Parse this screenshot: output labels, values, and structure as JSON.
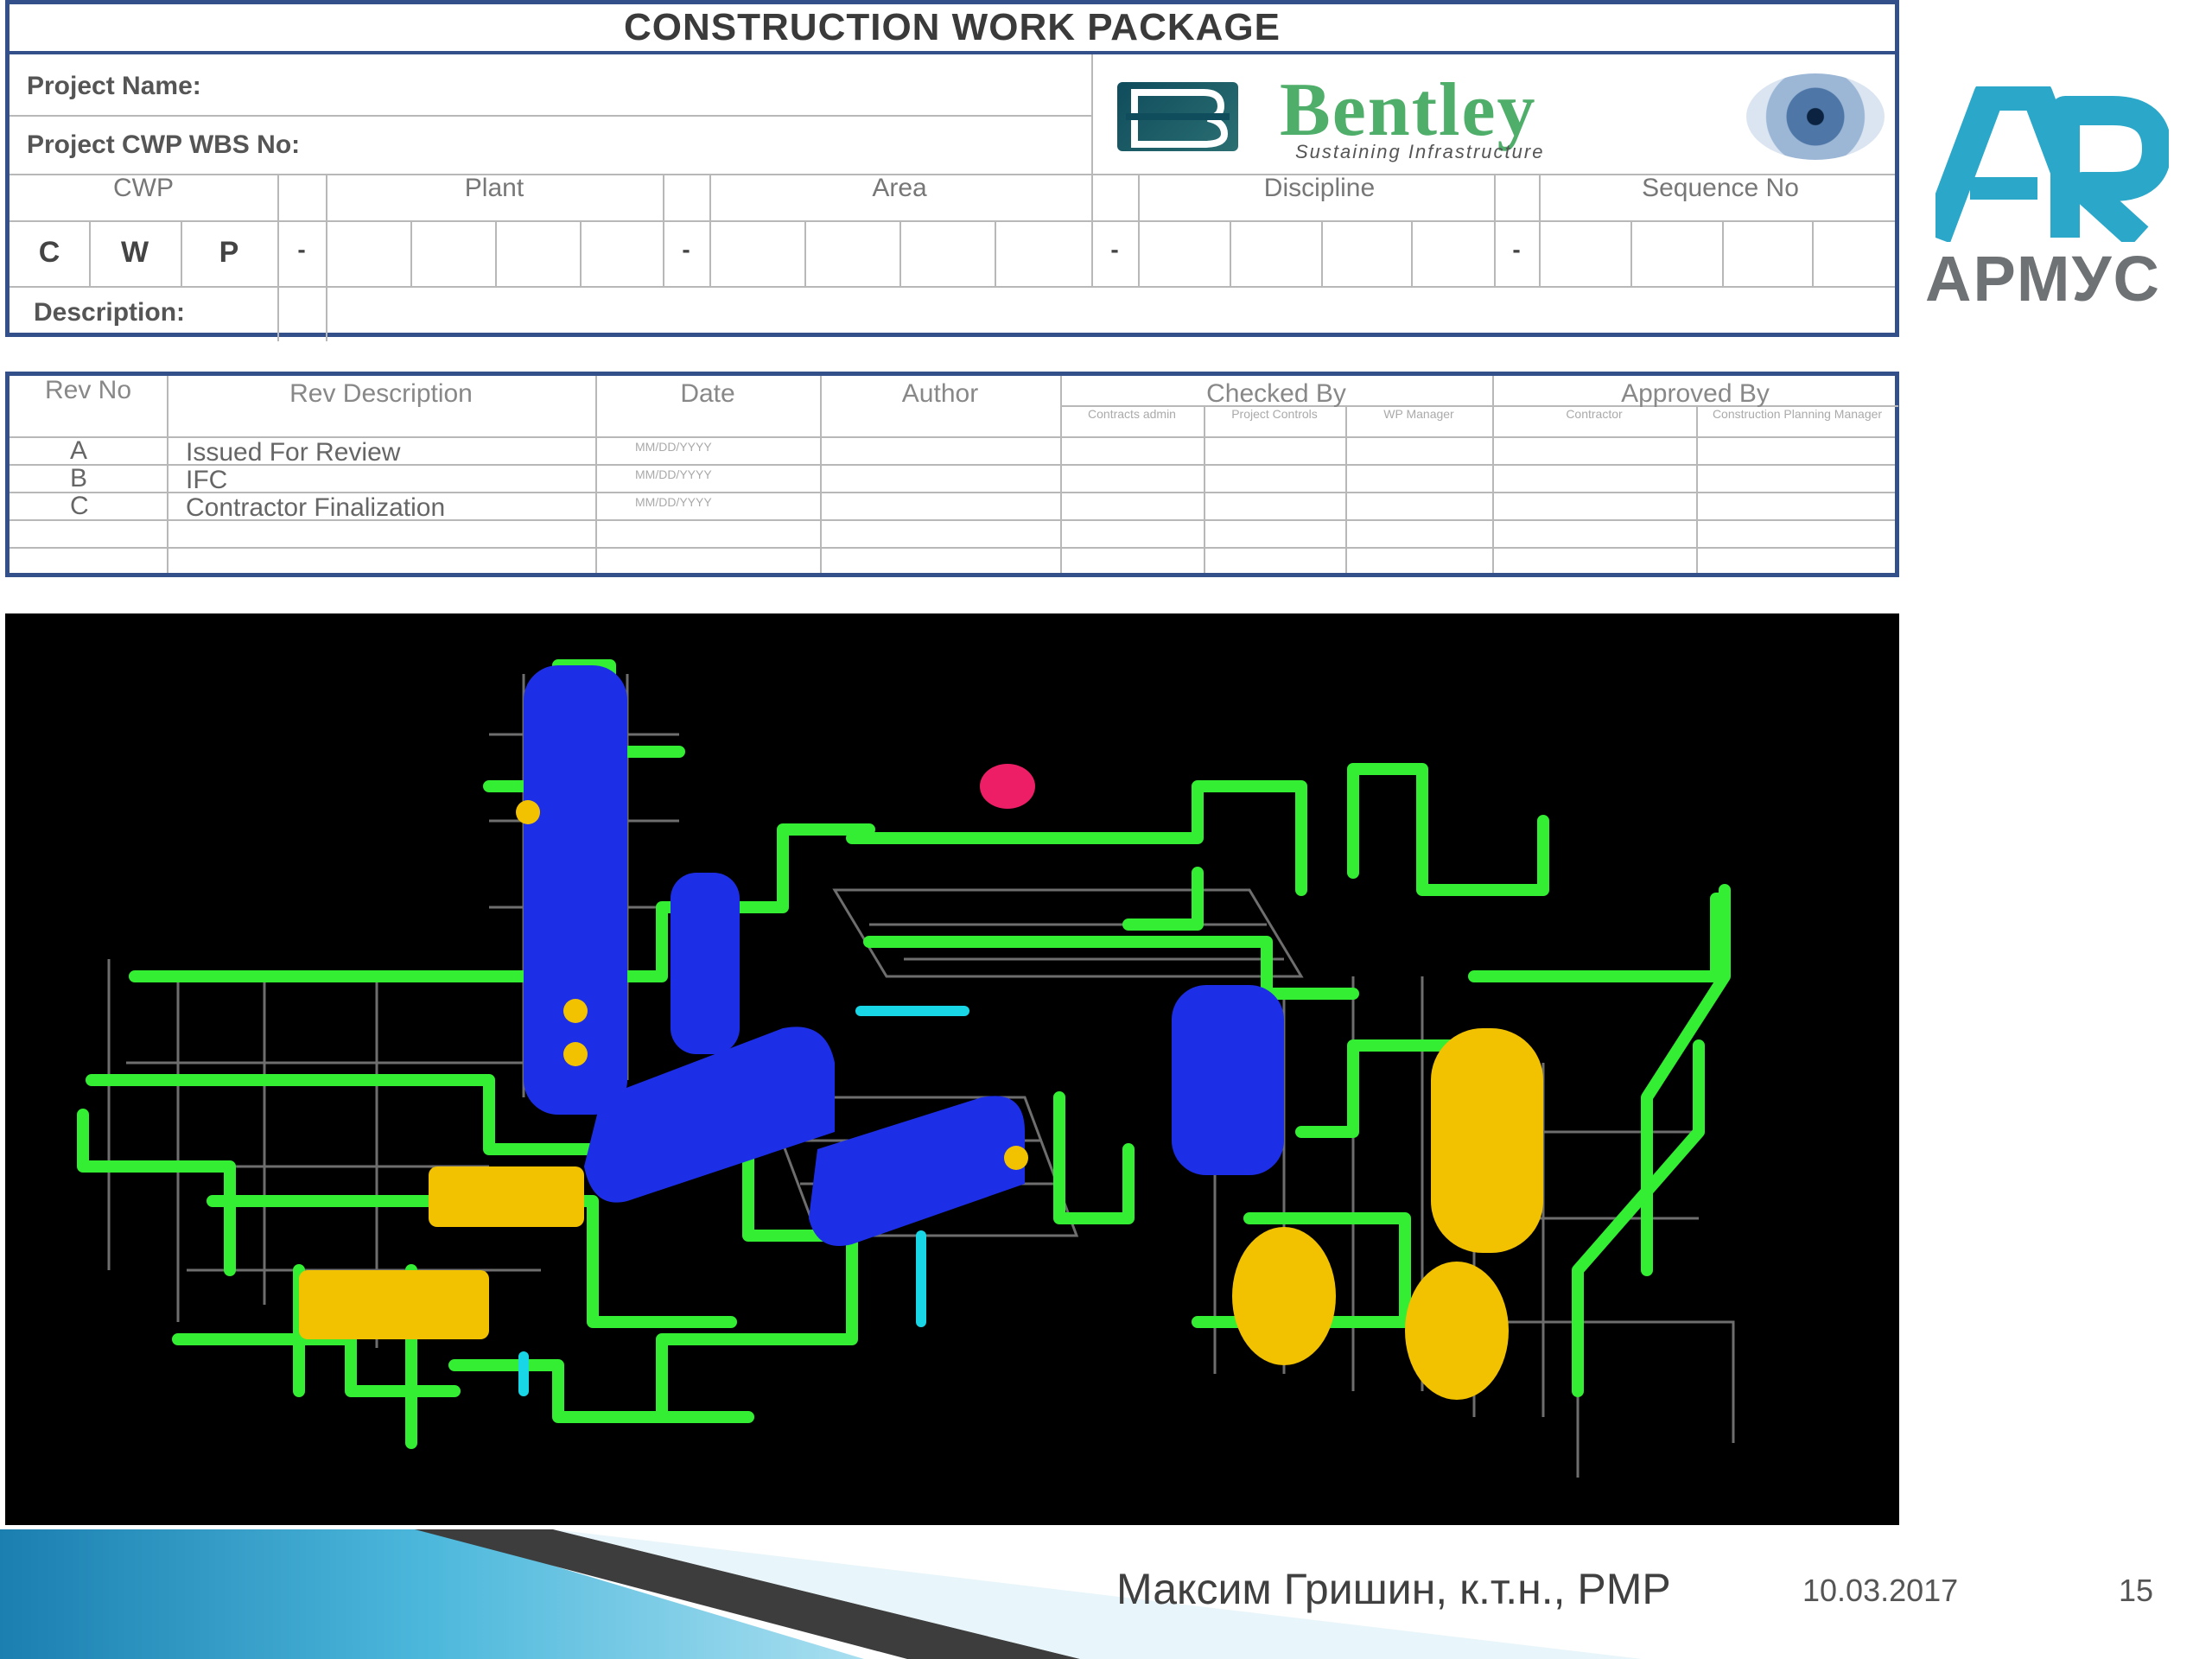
{
  "form": {
    "title": "CONSTRUCTION WORK PACKAGE",
    "project_name_label": "Project Name:",
    "project_wbs_label": "Project CWP WBS No:",
    "columns": [
      "CWP",
      "Plant",
      "Area",
      "Discipline",
      "Sequence No"
    ],
    "cwp_letters": [
      "C",
      "W",
      "P"
    ],
    "dash": "-",
    "description_label": "Description:"
  },
  "bentley_logo": {
    "wordmark": "Bentley",
    "tagline": "Sustaining Infrastructure",
    "brand_color": "#4fae6a"
  },
  "revisions": {
    "headers": {
      "rev_no": "Rev No",
      "rev_description": "Rev Description",
      "date": "Date",
      "author": "Author",
      "checked_by": "Checked By",
      "approved_by": "Approved By"
    },
    "checked_sub": [
      "Contracts admin",
      "Project Controls",
      "WP Manager"
    ],
    "approved_sub": [
      "Contractor",
      "Construction Planning Manager"
    ],
    "rows": [
      {
        "rev": "A",
        "description": "Issued For Review",
        "date": "MM/DD/YYYY"
      },
      {
        "rev": "B",
        "description": "IFC",
        "date": "MM/DD/YYYY"
      },
      {
        "rev": "C",
        "description": "Contractor Finalization",
        "date": "MM/DD/YYYY"
      }
    ]
  },
  "armus_logo": {
    "text": "АРМУС",
    "accent": "#2aa7c9"
  },
  "model_image": {
    "icon": "plant-3d-model",
    "background": "#000000",
    "pipe_color": "#33ee33",
    "vessel_color": "#1d2fe6",
    "tank_color": "#f2c200"
  },
  "footer": {
    "author": "Максим Гришин, к.т.н., PMP",
    "date": "10.03.2017",
    "page": "15"
  }
}
